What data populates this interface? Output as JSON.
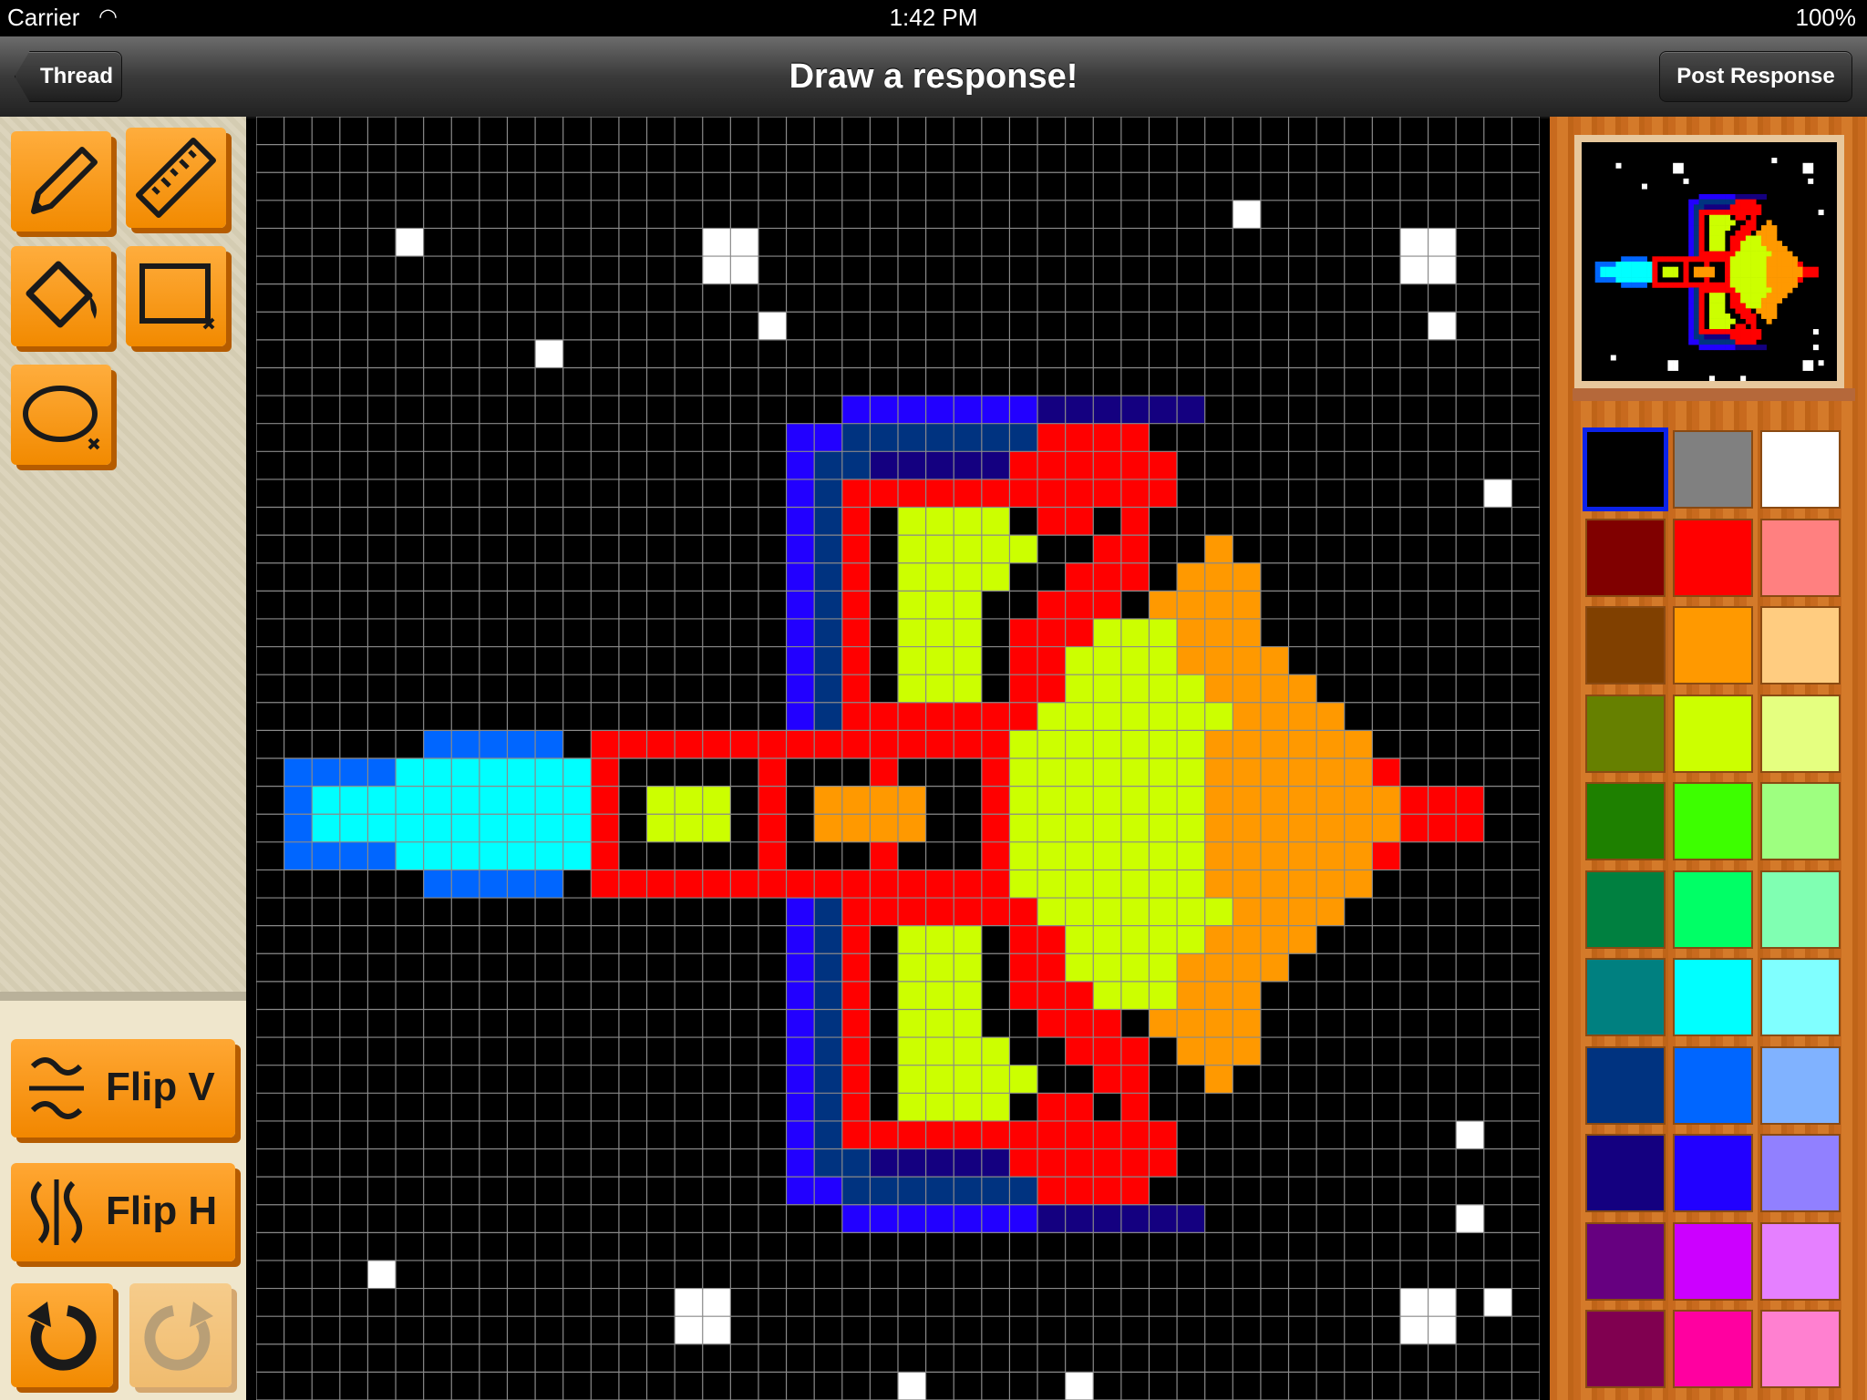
{
  "status_bar": {
    "carrier": "Carrier",
    "time": "1:42 PM",
    "battery": "100%"
  },
  "nav": {
    "back_label": "Thread",
    "title": "Draw a response!",
    "post_label": "Post Response"
  },
  "tools": [
    {
      "name": "pencil-tool"
    },
    {
      "name": "line-tool"
    },
    {
      "name": "fill-tool"
    },
    {
      "name": "rectangle-tool"
    },
    {
      "name": "ellipse-tool"
    }
  ],
  "buttons": {
    "flip_v": "Flip V",
    "flip_h": "Flip H"
  },
  "canvas": {
    "grid_size": 46
  },
  "palette": {
    "selected_index": 0,
    "colors": [
      "#000000",
      "#808080",
      "#ffffff",
      "#800000",
      "#ff0000",
      "#ff8080",
      "#804000",
      "#ff9900",
      "#ffcc80",
      "#668000",
      "#ccff00",
      "#e5ff80",
      "#1e8000",
      "#3dff00",
      "#9eff80",
      "#008040",
      "#00ff66",
      "#80ffb2",
      "#008080",
      "#00ffff",
      "#80ffff",
      "#003380",
      "#0066ff",
      "#80b2ff",
      "#140080",
      "#2200ff",
      "#9180ff",
      "#660080",
      "#cc00ff",
      "#e580ff",
      "#800050",
      "#ff00a0",
      "#ff80d0"
    ]
  },
  "pixel_art": {
    "legend": {
      "W": "#ffffff",
      "B": "#2200ff",
      "N": "#003380",
      "D": "#140080",
      "R": "#ff0000",
      "Y": "#ccff00",
      "O": "#ff9900",
      "L": "#0066ff",
      "C": "#00ffff"
    },
    "rows": [
      "..............................................",
      "..............................................",
      "..............................................",
      "...................................W..........",
      ".....W..........WW.......................WW...",
      "................WW.......................WW...",
      "..............................................",
      "..................W.......................W...",
      "..........W...................................",
      "..............................................",
      ".....................BBBBBBBDDDDDD............",
      "...................BBNNNNNNNRRRR..............",
      "...................BNNDDDDDRRRRRR.............",
      "...................BNRRRRRRRRRRRR...........W.",
      "...................BNR.YYYY.RR.R..............",
      "...................BNR.YYYYY..RR..O...........",
      "...................BNR.YYYY..RRR.OOO..........",
      "...................BNR.YYY..RRR.OOOO..........",
      "...................BNR.YYY.RRRYYYOOO...........",
      "...................BNR.YYY.RRYYYYOOOO.........",
      "...................BNR.YYY.RRYYYYYOOOO........",
      "...................BNRRRRRRRYYYYYYYOOOO.......",
      "......LLLLL.RRRRRRRRRRRRRRRYYYYYYYOOOOOO......",
      ".LLLLCCCCCCCR.....R...R...RYYYYYYYOOOOOOR.....",
      ".LCCCCCCCCCCR.YYY.R.OOOO..RYYYYYYYOOOOOOORRR..",
      ".LCCCCCCCCCCR.YYY.R.OOOO..RYYYYYYYOOOOOOORRR..",
      ".LLLLCCCCCCCR.....R...R...RYYYYYYYOOOOOOR.....",
      "......LLLLL.RRRRRRRRRRRRRRRYYYYYYYOOOOOO......",
      "...................BNRRRRRRRYYYYYYYOOOO.......",
      "...................BNR.YYY.RRYYYYYOOOO........",
      "...................BNR.YYY.RRYYYYOOOO.........",
      "...................BNR.YYY.RRRYYYOOO..........",
      "...................BNR.YYY..RRR.OOOO..........",
      "...................BNR.YYYY..RRR.OOO..........",
      "...................BNR.YYYYY..RR..O...........",
      "...................BNR.YYYY.RR.R..............",
      "...................BNRRRRRRRRRRRR..........W..",
      "...................BNNDDDDDRRRRRR.............",
      "...................BBNNNNNNNRRRR..............",
      ".....................BBBBBBBDDDDDD.........W..",
      "..............................................",
      "....W..........................................",
      "...............WW........................WW.W.",
      "...............WW........................WW...",
      "..............................................",
      ".......................W.....W................"
    ]
  }
}
